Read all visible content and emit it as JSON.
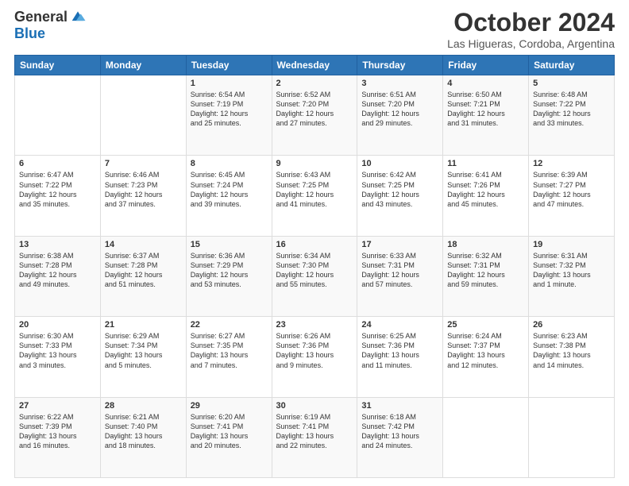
{
  "logo": {
    "general": "General",
    "blue": "Blue"
  },
  "header": {
    "title": "October 2024",
    "subtitle": "Las Higueras, Cordoba, Argentina"
  },
  "days": [
    "Sunday",
    "Monday",
    "Tuesday",
    "Wednesday",
    "Thursday",
    "Friday",
    "Saturday"
  ],
  "weeks": [
    [
      {
        "day": "",
        "content": ""
      },
      {
        "day": "",
        "content": ""
      },
      {
        "day": "1",
        "content": "Sunrise: 6:54 AM\nSunset: 7:19 PM\nDaylight: 12 hours\nand 25 minutes."
      },
      {
        "day": "2",
        "content": "Sunrise: 6:52 AM\nSunset: 7:20 PM\nDaylight: 12 hours\nand 27 minutes."
      },
      {
        "day": "3",
        "content": "Sunrise: 6:51 AM\nSunset: 7:20 PM\nDaylight: 12 hours\nand 29 minutes."
      },
      {
        "day": "4",
        "content": "Sunrise: 6:50 AM\nSunset: 7:21 PM\nDaylight: 12 hours\nand 31 minutes."
      },
      {
        "day": "5",
        "content": "Sunrise: 6:48 AM\nSunset: 7:22 PM\nDaylight: 12 hours\nand 33 minutes."
      }
    ],
    [
      {
        "day": "6",
        "content": "Sunrise: 6:47 AM\nSunset: 7:22 PM\nDaylight: 12 hours\nand 35 minutes."
      },
      {
        "day": "7",
        "content": "Sunrise: 6:46 AM\nSunset: 7:23 PM\nDaylight: 12 hours\nand 37 minutes."
      },
      {
        "day": "8",
        "content": "Sunrise: 6:45 AM\nSunset: 7:24 PM\nDaylight: 12 hours\nand 39 minutes."
      },
      {
        "day": "9",
        "content": "Sunrise: 6:43 AM\nSunset: 7:25 PM\nDaylight: 12 hours\nand 41 minutes."
      },
      {
        "day": "10",
        "content": "Sunrise: 6:42 AM\nSunset: 7:25 PM\nDaylight: 12 hours\nand 43 minutes."
      },
      {
        "day": "11",
        "content": "Sunrise: 6:41 AM\nSunset: 7:26 PM\nDaylight: 12 hours\nand 45 minutes."
      },
      {
        "day": "12",
        "content": "Sunrise: 6:39 AM\nSunset: 7:27 PM\nDaylight: 12 hours\nand 47 minutes."
      }
    ],
    [
      {
        "day": "13",
        "content": "Sunrise: 6:38 AM\nSunset: 7:28 PM\nDaylight: 12 hours\nand 49 minutes."
      },
      {
        "day": "14",
        "content": "Sunrise: 6:37 AM\nSunset: 7:28 PM\nDaylight: 12 hours\nand 51 minutes."
      },
      {
        "day": "15",
        "content": "Sunrise: 6:36 AM\nSunset: 7:29 PM\nDaylight: 12 hours\nand 53 minutes."
      },
      {
        "day": "16",
        "content": "Sunrise: 6:34 AM\nSunset: 7:30 PM\nDaylight: 12 hours\nand 55 minutes."
      },
      {
        "day": "17",
        "content": "Sunrise: 6:33 AM\nSunset: 7:31 PM\nDaylight: 12 hours\nand 57 minutes."
      },
      {
        "day": "18",
        "content": "Sunrise: 6:32 AM\nSunset: 7:31 PM\nDaylight: 12 hours\nand 59 minutes."
      },
      {
        "day": "19",
        "content": "Sunrise: 6:31 AM\nSunset: 7:32 PM\nDaylight: 13 hours\nand 1 minute."
      }
    ],
    [
      {
        "day": "20",
        "content": "Sunrise: 6:30 AM\nSunset: 7:33 PM\nDaylight: 13 hours\nand 3 minutes."
      },
      {
        "day": "21",
        "content": "Sunrise: 6:29 AM\nSunset: 7:34 PM\nDaylight: 13 hours\nand 5 minutes."
      },
      {
        "day": "22",
        "content": "Sunrise: 6:27 AM\nSunset: 7:35 PM\nDaylight: 13 hours\nand 7 minutes."
      },
      {
        "day": "23",
        "content": "Sunrise: 6:26 AM\nSunset: 7:36 PM\nDaylight: 13 hours\nand 9 minutes."
      },
      {
        "day": "24",
        "content": "Sunrise: 6:25 AM\nSunset: 7:36 PM\nDaylight: 13 hours\nand 11 minutes."
      },
      {
        "day": "25",
        "content": "Sunrise: 6:24 AM\nSunset: 7:37 PM\nDaylight: 13 hours\nand 12 minutes."
      },
      {
        "day": "26",
        "content": "Sunrise: 6:23 AM\nSunset: 7:38 PM\nDaylight: 13 hours\nand 14 minutes."
      }
    ],
    [
      {
        "day": "27",
        "content": "Sunrise: 6:22 AM\nSunset: 7:39 PM\nDaylight: 13 hours\nand 16 minutes."
      },
      {
        "day": "28",
        "content": "Sunrise: 6:21 AM\nSunset: 7:40 PM\nDaylight: 13 hours\nand 18 minutes."
      },
      {
        "day": "29",
        "content": "Sunrise: 6:20 AM\nSunset: 7:41 PM\nDaylight: 13 hours\nand 20 minutes."
      },
      {
        "day": "30",
        "content": "Sunrise: 6:19 AM\nSunset: 7:41 PM\nDaylight: 13 hours\nand 22 minutes."
      },
      {
        "day": "31",
        "content": "Sunrise: 6:18 AM\nSunset: 7:42 PM\nDaylight: 13 hours\nand 24 minutes."
      },
      {
        "day": "",
        "content": ""
      },
      {
        "day": "",
        "content": ""
      }
    ]
  ]
}
